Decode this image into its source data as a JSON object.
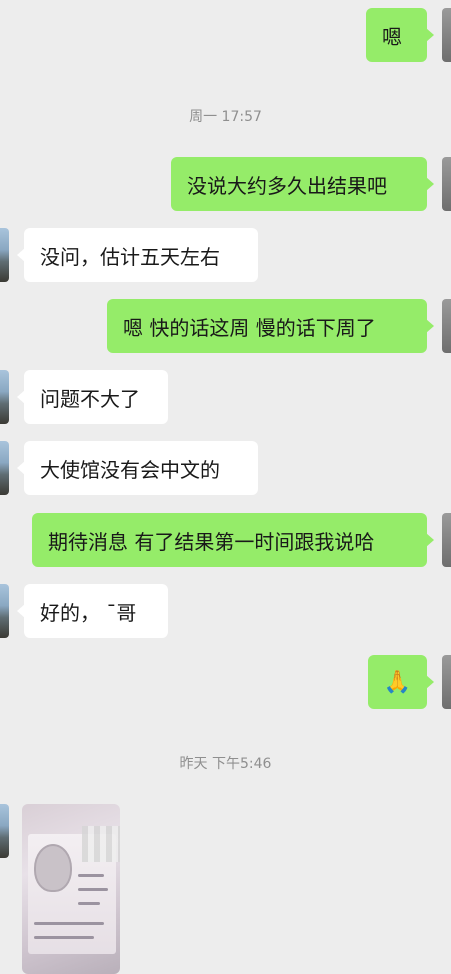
{
  "messages": [
    {
      "dir": "out",
      "text": "嗯"
    },
    {
      "dir": "ts",
      "text": "周一 17:57"
    },
    {
      "dir": "out",
      "text": "没说大约多久出结果吧"
    },
    {
      "dir": "in",
      "text": "没问，估计五天左右"
    },
    {
      "dir": "out",
      "text": "嗯 快的话这周  慢的话下周了"
    },
    {
      "dir": "in",
      "text": "问题不大了"
    },
    {
      "dir": "in",
      "text": "大使馆没有会中文的"
    },
    {
      "dir": "out",
      "text": "期待消息 有了结果第一时间跟我说哈"
    },
    {
      "dir": "in",
      "text": "好的，  ˉ哥"
    },
    {
      "dir": "out",
      "text": "🙏"
    },
    {
      "dir": "ts",
      "text": "昨天 下午5:46"
    },
    {
      "dir": "in",
      "text": "[image]"
    }
  ],
  "colors": {
    "outgoing": "#95ec69",
    "incoming": "#ffffff",
    "background": "#ededed",
    "timestamp": "#8f8f8f"
  }
}
